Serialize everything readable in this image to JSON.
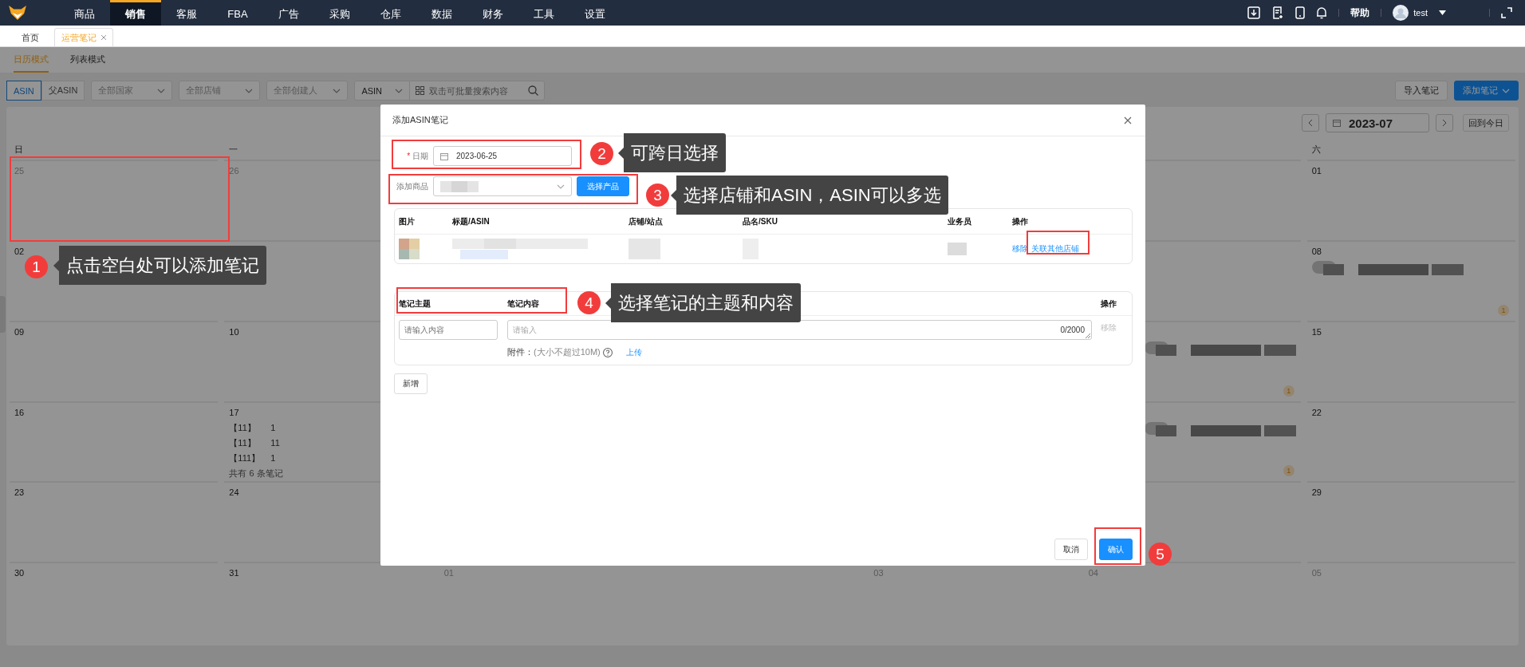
{
  "nav": {
    "items": [
      {
        "label": "商品",
        "selected": false
      },
      {
        "label": "销售",
        "selected": true
      },
      {
        "label": "客服",
        "selected": false
      },
      {
        "label": "FBA",
        "selected": false
      },
      {
        "label": "广告",
        "selected": false
      },
      {
        "label": "采购",
        "selected": false
      },
      {
        "label": "仓库",
        "selected": false
      },
      {
        "label": "数据",
        "selected": false
      },
      {
        "label": "财务",
        "selected": false
      },
      {
        "label": "工具",
        "selected": false
      },
      {
        "label": "设置",
        "selected": false
      }
    ],
    "help": "帮助",
    "user": "test"
  },
  "tabs": [
    {
      "label": "首页",
      "selected": false,
      "closable": false
    },
    {
      "label": "运营笔记",
      "selected": true,
      "closable": true
    }
  ],
  "modes": [
    {
      "label": "日历模式",
      "selected": true
    },
    {
      "label": "列表模式",
      "selected": false
    }
  ],
  "filters": {
    "scope": [
      {
        "label": "ASIN",
        "selected": true
      },
      {
        "label": "父ASIN",
        "selected": false
      }
    ],
    "selects": [
      {
        "placeholder": "全部国家"
      },
      {
        "placeholder": "全部店铺"
      },
      {
        "placeholder": "全部创建人"
      }
    ],
    "search_type": "ASIN",
    "search": {
      "placeholder": "双击可批量搜索内容"
    }
  },
  "actions": {
    "import": "导入笔记",
    "add": "添加笔记"
  },
  "calendar": {
    "month": "2023-07",
    "today": "回到今日",
    "weekdays": [
      {
        "kind": "sun",
        "label": "日"
      },
      {
        "kind": "mon",
        "label": "一"
      },
      {
        "kind": "sat",
        "label": "六"
      }
    ],
    "weeks": [
      [
        {
          "kind": "sun",
          "date": "25",
          "muted": true
        },
        {
          "kind": "mon",
          "date": "26",
          "muted": true
        },
        {
          "kind": "sat",
          "date": "01",
          "muted": false
        }
      ],
      [
        {
          "kind": "sun",
          "date": "02",
          "muted": false
        },
        {
          "kind": "sat",
          "date": "08",
          "muted": false,
          "blurred": true,
          "badge": "1"
        }
      ],
      [
        {
          "kind": "sun",
          "date": "09",
          "muted": false
        },
        {
          "kind": "mon",
          "date": "10",
          "muted": false
        },
        {
          "kind": "fri",
          "blurred": true,
          "badge": "1"
        },
        {
          "kind": "sat",
          "date": "15",
          "muted": false
        }
      ],
      [
        {
          "kind": "sun",
          "date": "16",
          "muted": false
        },
        {
          "kind": "mon",
          "date": "17",
          "muted": false,
          "entries": [
            {
              "tag": "【11】",
              "text": "1"
            },
            {
              "tag": "【11】",
              "text": "11"
            },
            {
              "tag": "【111】",
              "text": "1"
            }
          ],
          "summary": "共有 6 条笔记"
        },
        {
          "kind": "fri",
          "blurred": true,
          "badge": "1"
        },
        {
          "kind": "sat",
          "date": "22",
          "muted": false
        }
      ],
      [
        {
          "kind": "sun",
          "date": "23",
          "muted": false
        },
        {
          "kind": "mon",
          "date": "24",
          "muted": false
        },
        {
          "kind": "sat",
          "date": "29",
          "muted": false
        }
      ],
      [
        {
          "kind": "sun",
          "date": "30",
          "muted": false
        },
        {
          "kind": "mon",
          "date": "31",
          "muted": false
        },
        {
          "kind": "tue",
          "date": "01",
          "muted": true
        },
        {
          "kind": "thu",
          "date": "03",
          "muted": true
        },
        {
          "kind": "fri",
          "date": "04",
          "muted": true
        },
        {
          "kind": "sat",
          "date": "05",
          "muted": true
        }
      ]
    ]
  },
  "dialog": {
    "title": "添加ASIN笔记",
    "date": {
      "required_mark": "*",
      "label": "日期",
      "value": "2023-06-25"
    },
    "product": {
      "label": "添加商品",
      "button": "选择产品"
    },
    "product_table": {
      "columns": [
        "图片",
        "标题/ASIN",
        "店铺/站点",
        "品名/SKU",
        "业务员",
        "操作"
      ],
      "rows": [
        {
          "actions": [
            "移除",
            "关联其他店铺"
          ]
        }
      ]
    },
    "notes_table": {
      "columns": [
        "笔记主题",
        "笔记内容",
        "操作"
      ],
      "rows": [
        {
          "topic_placeholder": "请输入内容",
          "content_placeholder": "请输入",
          "counter": "0/2000",
          "remove": "移除",
          "remove_disabled": true,
          "attachment_label": "附件：",
          "attachment_hint": "(大小不超过10M)",
          "upload": "上传"
        }
      ]
    },
    "add_row": "新增",
    "cancel": "取消",
    "confirm": "确认"
  },
  "annotations": [
    {
      "number": "1",
      "text": "点击空白处可以添加笔记"
    },
    {
      "number": "2",
      "text": "可跨日选择"
    },
    {
      "number": "3",
      "text": "选择店铺和ASIN，ASIN可以多选"
    },
    {
      "number": "4",
      "text": "选择笔记的主题和内容"
    },
    {
      "number": "5"
    }
  ]
}
